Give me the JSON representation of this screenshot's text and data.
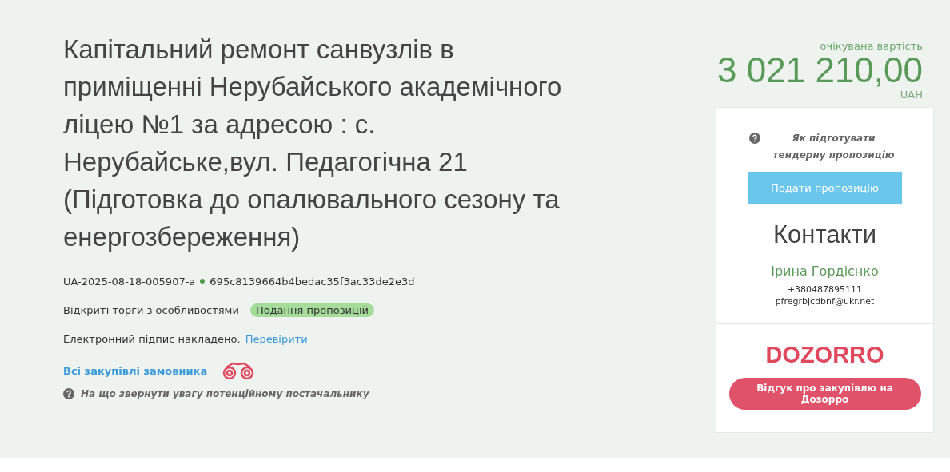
{
  "tender": {
    "title": "Капітальний ремонт санвузлів в приміщенні Нерубайського академічного ліцею №1 за адресою : с. Нерубайське,вул. Педагогічна 21 (Підготовка до опалювального сезону та енергозбереження)",
    "id": "UA-2025-08-18-005907-a",
    "hash": "695c8139664b4bedac35f3ac33de2e3d",
    "procedure": "Відкриті торги з особливостями",
    "status": {
      "label": "Подання пропозицій",
      "color": "#a5dc9a"
    },
    "signature": "Електронний підпис накладено.",
    "signature_link": "Перевірити",
    "buyer_link": "Всі закупівлі замовника",
    "hint": "На що звернути увагу потенційному постачальнику"
  },
  "value": {
    "label": "очікувана вартість",
    "amount": "3 021 210,00",
    "currency": "UAH"
  },
  "panel": {
    "help": "Як підготувати тендерну пропозицію",
    "submit": "Подати пропозицію",
    "contacts_title": "Контакти",
    "contact": {
      "name": "Ірина Гордієнко",
      "phone": "+380487895111",
      "email": "pfregrbjcdbnf@ukr.net"
    },
    "logo": "DOZORRO",
    "feedback": "Відгук про закупівлю на Дозорро"
  }
}
